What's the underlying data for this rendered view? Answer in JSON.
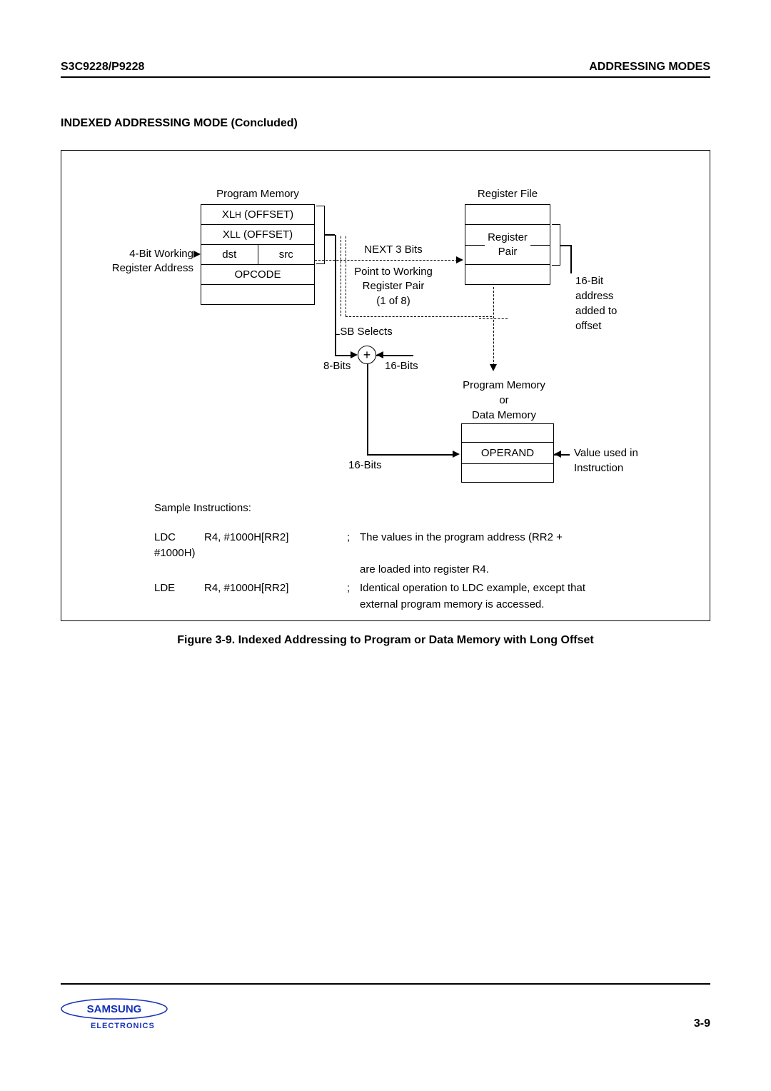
{
  "header": {
    "left": "S3C9228/P9228",
    "right": "ADDRESSING MODES"
  },
  "section_title": "INDEXED ADDRESSING MODE (Concluded)",
  "diagram": {
    "pm_title": "Program Memory",
    "rf_title": "Register File",
    "xlh_prefix": "XL",
    "xlh_small": "H",
    "xlh_suffix": " (OFFSET)",
    "xll_prefix": "XL",
    "xll_small": "L",
    "xll_suffix": " (OFFSET)",
    "dst": "dst",
    "src": "src",
    "opcode": "OPCODE",
    "reg_pair": "Register\nPair",
    "left_label": "4-Bit Working\nRegister Address",
    "next3": "NEXT 3 Bits",
    "ptw": "Point to Working\nRegister Pair\n(1 of 8)",
    "right_note": "16-Bit\naddress\nadded to\noffset",
    "lsb": "LSB Selects",
    "plus": "+",
    "bits8": "8-Bits",
    "bits16a": "16-Bits",
    "pm_or": "Program Memory\nor\nData Memory",
    "operand": "OPERAND",
    "val_note": "Value used in\nInstruction",
    "bits16b": "16-Bits",
    "samples_title": "Sample Instructions:",
    "row1_mn": "LDC",
    "row1_ops": "R4, #1000H[RR2]",
    "row1_sc": ";",
    "row1_cm": "The values in the program address (RR2 +",
    "row1_sub": "#1000H)",
    "row2_cm": "are loaded into register R4.",
    "row3_mn": "LDE",
    "row3_ops": "R4, #1000H[RR2]",
    "row3_sc": ";",
    "row3_cm": "Identical operation to LDC example, except that\nexternal program memory is accessed."
  },
  "caption": "Figure 3-9. Indexed Addressing to Program or Data Memory with Long Offset",
  "footer": {
    "logo_text": "SAMSUNG",
    "electronics": "ELECTRONICS",
    "page_num": "3-9"
  }
}
